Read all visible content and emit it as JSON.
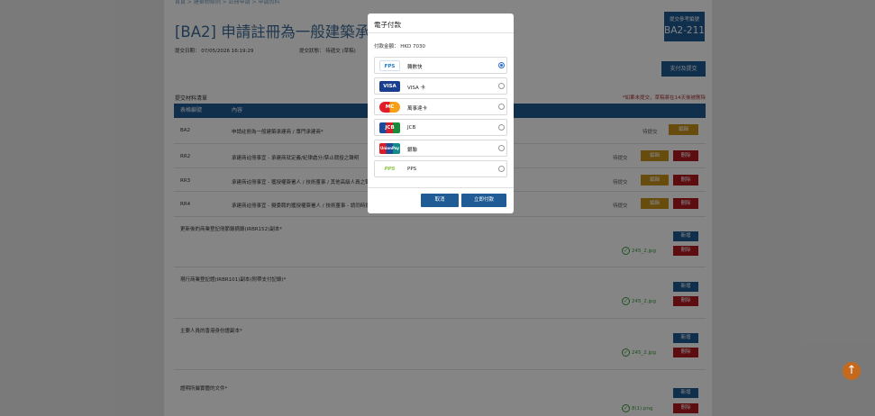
{
  "topnav": {
    "text": "首頁 > 建築物條例 > 註冊申請 > 申請資料"
  },
  "header": {
    "title": "[BA2] 申請註冊為一般建築承建商",
    "submit_date": "提交日期： 07/05/2026 16:19:29",
    "submit_status": "提交狀態： 待遞交 (草稿)",
    "ref_label": "提交參考編號",
    "ref_value": "BA2-211",
    "pay_button": "支付及提交"
  },
  "materials": {
    "section_title": "提交材料清單",
    "note": "*如果未提交，草稿將在14天後被刪除",
    "columns": [
      "表格編號",
      "內容"
    ],
    "rows": [
      {
        "code": "BA2",
        "desc": "申請註冊為一般建築承建商 / 專門承建商*",
        "status": "待提交",
        "edit": "編輯",
        "delete": ""
      },
      {
        "code": "RR2",
        "desc": "承建商註冊事宜 - 承建商就定義/紀律處分/禁止競投之聲明",
        "status": "待提交",
        "edit": "編輯",
        "delete": "刪除"
      },
      {
        "code": "RR3",
        "desc": "承建商註冊事宜 - 獲授權簽署人 / 技術董事 / 其他高級人員之聲明*",
        "status": "待提交",
        "edit": "編輯",
        "delete": "刪除"
      },
      {
        "code": "RR4",
        "desc": "承建商註冊事宜 - 擬委聘的獲授權簽署人 / 技術董事 - 請同時提交BA2及BA2C)*",
        "status": "待提交",
        "edit": "編輯",
        "delete": "刪除"
      }
    ],
    "uploads": [
      {
        "label": "更新後的商業登記冊節錄摘錄(IRBR152)副本*",
        "add": "新增",
        "file": "245_2.jpg",
        "delete": "刪除"
      },
      {
        "label": "現行商業登記證(IRBR101)副本(附帶支付記錄)*",
        "add": "新增",
        "file": "245_2.jpg",
        "delete": "刪除"
      },
      {
        "label": "主要人員的香港身份證副本*",
        "add": "新增",
        "file": "245_2.jpg",
        "delete": "刪除"
      },
      {
        "label": "證明所屬實體的文件*",
        "add": "新增",
        "file": "8(1).png",
        "delete": "刪除"
      }
    ]
  },
  "modal": {
    "title": "電子付款",
    "amount": "付款金額： HKD 7030",
    "options": [
      {
        "name": "轉數快",
        "logo": "FPS",
        "icon": "fps-icon",
        "selected": true
      },
      {
        "name": "VISA 卡",
        "logo": "VISA",
        "icon": "visa-icon",
        "selected": false
      },
      {
        "name": "萬事達卡",
        "logo": "MC",
        "icon": "mastercard-icon",
        "selected": false
      },
      {
        "name": "JCB",
        "logo": "JCB",
        "icon": "jcb-icon",
        "selected": false
      },
      {
        "name": "銀聯",
        "logo": "UnionPay",
        "icon": "unionpay-icon",
        "selected": false
      },
      {
        "name": "PPS",
        "logo": "PPS",
        "icon": "pps-icon",
        "selected": false
      }
    ],
    "cancel": "取消",
    "pay_now": "立即付款"
  },
  "colors": {
    "primary": "#1f5b94",
    "edit": "#c8931b",
    "delete": "#b2171e",
    "scroll_top": "#c56a1d",
    "success": "#3a9a3a"
  }
}
